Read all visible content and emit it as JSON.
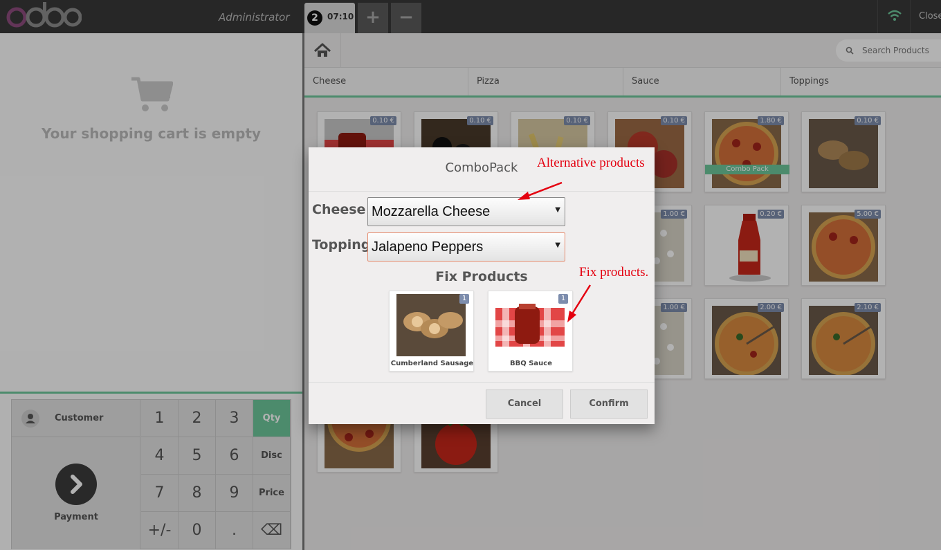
{
  "topbar": {
    "user": "Administrator",
    "order_number": "2",
    "order_time": "07:10",
    "add_label": "+",
    "remove_label": "−",
    "close_label": "Close"
  },
  "cart": {
    "empty_text": "Your shopping cart is empty"
  },
  "numpad": {
    "customer_label": "Customer",
    "payment_label": "Payment",
    "keys": [
      "1",
      "2",
      "3",
      "4",
      "5",
      "6",
      "7",
      "8",
      "9",
      "+/-",
      "0",
      "."
    ],
    "modes": [
      "Qty",
      "Disc",
      "Price"
    ],
    "active_mode": "Qty",
    "backspace_icon": "⌫"
  },
  "search": {
    "placeholder": "Search Products"
  },
  "categories": [
    "Cheese",
    "Pizza",
    "Sauce",
    "Toppings"
  ],
  "products": [
    {
      "price": "0.10 €",
      "image": "bbq-sauce"
    },
    {
      "price": "0.10 €",
      "image": "olives"
    },
    {
      "price": "0.10 €",
      "image": "fries"
    },
    {
      "price": "0.10 €",
      "image": "salami"
    },
    {
      "price": "1.80 €",
      "image": "pizza",
      "band": "Combo Pack"
    },
    {
      "price": "0.10 €",
      "image": "sausage"
    },
    {
      "price": "1.00 €",
      "image": "cheese-crumbs"
    },
    {
      "price": "0.20 €",
      "image": "ketchup"
    },
    {
      "price": "5.00 €",
      "image": "pizza"
    },
    {
      "price": "1.00 €",
      "image": "cheese-crumbs"
    },
    {
      "price": "2.00 €",
      "image": "pizza-slice"
    },
    {
      "price": "2.10 €",
      "image": "pizza-slice"
    },
    {
      "price": "",
      "image": "pizza"
    },
    {
      "price": "",
      "image": "tomato"
    }
  ],
  "modal": {
    "title": "ComboPack",
    "fields": [
      {
        "label": "Cheese",
        "value": "Mozzarella Cheese"
      },
      {
        "label": "Toppings",
        "value": "Jalapeno Peppers"
      }
    ],
    "fix_title": "Fix Products",
    "fix_products": [
      {
        "name": "Cumberland Sausage",
        "qty": "1",
        "image": "sausage"
      },
      {
        "name": "BBQ Sauce",
        "qty": "1",
        "image": "bbq-sauce"
      }
    ],
    "cancel_label": "Cancel",
    "confirm_label": "Confirm"
  },
  "annotations": {
    "alternative": "Alternative products",
    "fix": "Fix products."
  },
  "colors": {
    "accent": "#6ec89b",
    "topbar": "#393939",
    "price_tag": "#7d8dad",
    "annotation": "#e4000f",
    "logo_purple": "#8f4d7f"
  }
}
